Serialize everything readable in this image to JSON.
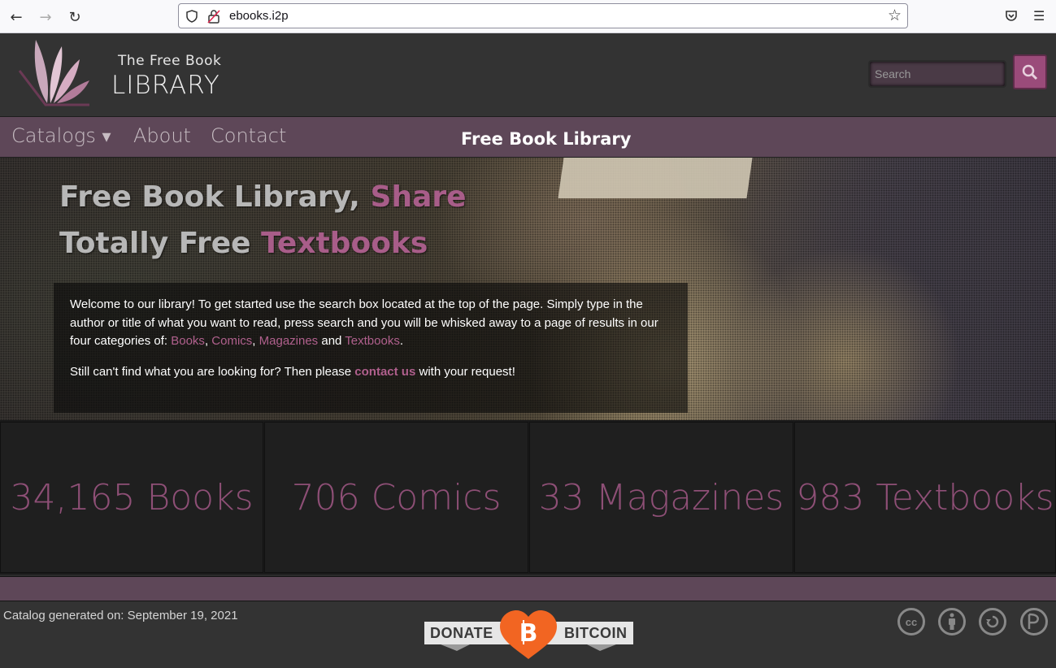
{
  "browser": {
    "url": "ebooks.i2p",
    "back_icon": "←",
    "forward_icon": "→",
    "reload_icon": "↻",
    "bookmark_icon": "☆",
    "menu_icon": "☰"
  },
  "header": {
    "logo_line1": "The Free Book",
    "logo_line2": "LIBRARY",
    "search_placeholder": "Search"
  },
  "nav": {
    "items": [
      {
        "label": "Catalogs"
      },
      {
        "label": "About"
      },
      {
        "label": "Contact"
      }
    ],
    "dropdown_caret": "▾",
    "site_title": "Free Book Library"
  },
  "hero": {
    "line1_prefix": "Free Book Library, ",
    "line1_highlight": "Share",
    "line2_prefix": "Totally Free ",
    "line2_highlight": "Textbooks",
    "welcome_text": "Welcome to our library! To get started use the search box located at the top of the page. Simply type in the author or title of what you want to read, press search and you will be whisked away to a page of results in our four categories of: ",
    "categories": [
      "Books",
      "Comics",
      "Magazines",
      "Textbooks"
    ],
    "sep1": ", ",
    "sep2": ", ",
    "sep3": " and ",
    "end": ".",
    "still_prefix": "Still can't find what you are looking for? Then please ",
    "contact_link": "contact us",
    "still_suffix": " with your request!"
  },
  "stats": [
    {
      "label": "34,165 Books"
    },
    {
      "label": "706 Comics"
    },
    {
      "label": "33 Magazines"
    },
    {
      "label": "983 Textbooks"
    }
  ],
  "footer": {
    "catalog_date": "Catalog generated on: September 19, 2021",
    "donate_left": "DONATE",
    "donate_right": "BITCOIN",
    "cc_icons": [
      "creative-commons",
      "attribution",
      "share-alike",
      "pirate-party"
    ]
  },
  "colors": {
    "accent": "#9a4b7a",
    "nav_bg": "#5e4758",
    "header_bg": "#333333",
    "stat_text": "#8e4f76",
    "bitcoin_orange": "#f26522"
  }
}
